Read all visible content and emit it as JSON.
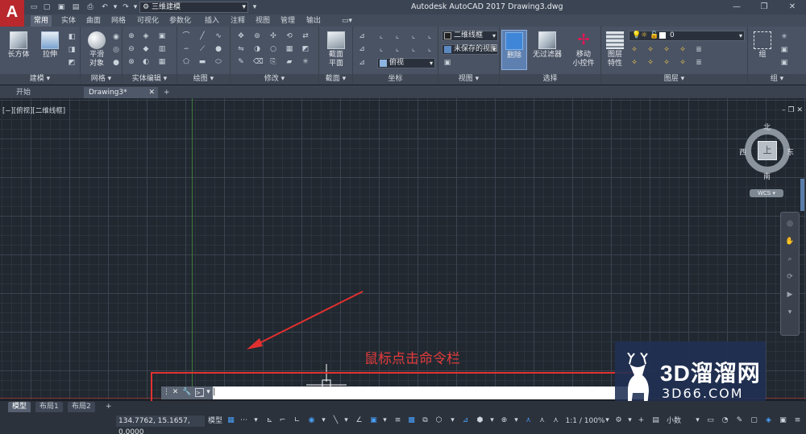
{
  "app": {
    "window_title": "Autodesk AutoCAD 2017    Drawing3.dwg",
    "logo": "A",
    "workspace": "三维建模"
  },
  "ribbon_tabs": [
    "常用",
    "实体",
    "曲面",
    "网格",
    "可视化",
    "参数化",
    "插入",
    "注释",
    "视图",
    "管理",
    "输出"
  ],
  "panels": {
    "model": {
      "title": "建模",
      "box_label": "长方体",
      "extrude_label": "拉伸"
    },
    "mesh": {
      "title": "网格",
      "smooth_label": "平滑\n对象"
    },
    "solid_edit": {
      "title": "实体编辑"
    },
    "draw": {
      "title": "绘图"
    },
    "modify": {
      "title": "修改"
    },
    "section": {
      "title": "截面",
      "plane_label": "截面\n平面"
    },
    "coords": {
      "title": "坐标",
      "view_combo": "俯视"
    },
    "view": {
      "title": "视图",
      "visual_style": "二维线框",
      "saved_view": "未保存的视图"
    },
    "selection": {
      "title": "选择",
      "cull_label": "删除",
      "nofilter_label": "无过滤器",
      "gizmo_label": "移动\n小控件"
    },
    "layers": {
      "title": "图层",
      "layer_props_label": "图层\n特性",
      "current_layer": "0"
    },
    "groups": {
      "title": "组",
      "group_label": "组"
    }
  },
  "doc_tabs": [
    "开始",
    "Drawing3*"
  ],
  "viewport": {
    "label": "[−][俯视][二维线框]",
    "viewcube": {
      "top": "上",
      "north": "北",
      "south": "南",
      "east": "东",
      "west": "西",
      "wcs": "WCS"
    }
  },
  "annotation": {
    "text": "鼠标点击命令栏",
    "color": "#e43b3b"
  },
  "command_line": {
    "prompt": "|"
  },
  "watermark": {
    "brand": "3D溜溜网",
    "url": "3D66.COM"
  },
  "layout_tabs": [
    "模型",
    "布局1",
    "布局2"
  ],
  "status_bar": {
    "coordinates": "134.7762, 15.1657, 0.0000",
    "model_label": "模型",
    "scale": "1:1 / 100%",
    "units": "小数"
  }
}
